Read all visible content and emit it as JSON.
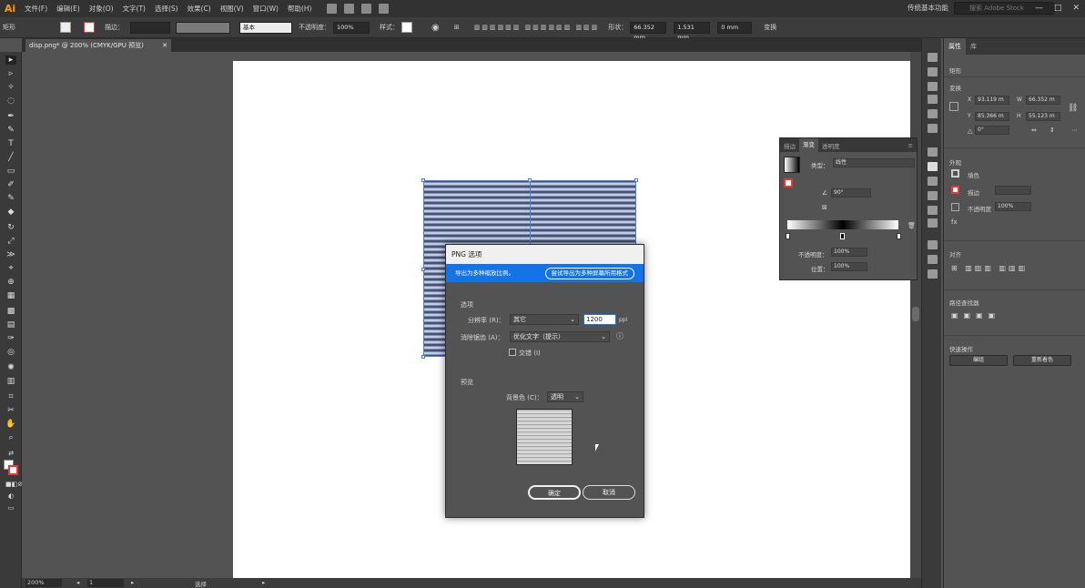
{
  "app": {
    "logo": "Ai",
    "menus": [
      "文件(F)",
      "编辑(E)",
      "对象(O)",
      "文字(T)",
      "选择(S)",
      "效果(C)",
      "视图(V)",
      "窗口(W)",
      "帮助(H)"
    ],
    "workspace": "传统基本功能",
    "search_placeholder": "搜索 Adobe Stock",
    "window_buttons": [
      "—",
      "□",
      "✕"
    ]
  },
  "control_bar": {
    "selection": "矩形",
    "stroke_label": "描边：",
    "stroke_style": "基本",
    "opacity_label": "不透明度：",
    "opacity_value": "100%",
    "style_label": "样式：",
    "shape_label": "形状：",
    "width_value": "66.352 mm",
    "height_value": "1.531 mm",
    "corner_value": "0 mm",
    "transform_label": "变换"
  },
  "document": {
    "tab_title": "disp.png* @ 200% (CMYK/GPU 预览)",
    "tab_close": "✕"
  },
  "status": {
    "zoom": "200%",
    "page": "1",
    "tool": "选择"
  },
  "gradient_panel": {
    "tabs": [
      "描边",
      "渐变",
      "透明度"
    ],
    "type_label": "类型：",
    "type_value": "线性",
    "angle_value": "90°",
    "opacity_label": "不透明度：",
    "opacity_value": "100%",
    "position_label": "位置：",
    "position_value": "100%"
  },
  "right_panel": {
    "tabs": [
      "属性",
      "库"
    ],
    "object_type": "矩形",
    "transform_title": "变换",
    "x": "93.119 m",
    "y": "85.366 m",
    "w": "66.352 m",
    "h": "55.123 m",
    "rotation": "0°",
    "appearance_title": "外观",
    "fill_label": "填色",
    "stroke_label": "描边",
    "opacity_label": "不透明度",
    "opacity_value": "100%",
    "align_title": "对齐",
    "pathfinder_title": "路径查找器",
    "quick_actions_title": "快速操作",
    "edit_button": "编组",
    "recolor_button": "重新着色"
  },
  "dialog": {
    "title": "PNG 选项",
    "banner_text": "导出为多种缩放比例。",
    "banner_button": "尝试导出为多种屏幕所用格式",
    "options_header": "选项",
    "resolution_label": "分辨率 (R)：",
    "resolution_value": "其它",
    "ppi_value": "1200",
    "ppi_unit": "ppi",
    "antialias_label": "消除锯齿 (A)：",
    "antialias_value": "优化文字（提示）",
    "interlace_label": "交错 (I)",
    "preview_header": "预览",
    "bg_label": "背景色 (C)：",
    "bg_value": "透明",
    "ok_button": "确定",
    "cancel_button": "取消"
  },
  "colors": {
    "accent": "#1473e6",
    "selection": "#4a7bdc",
    "app_orange": "#ff9a00"
  }
}
